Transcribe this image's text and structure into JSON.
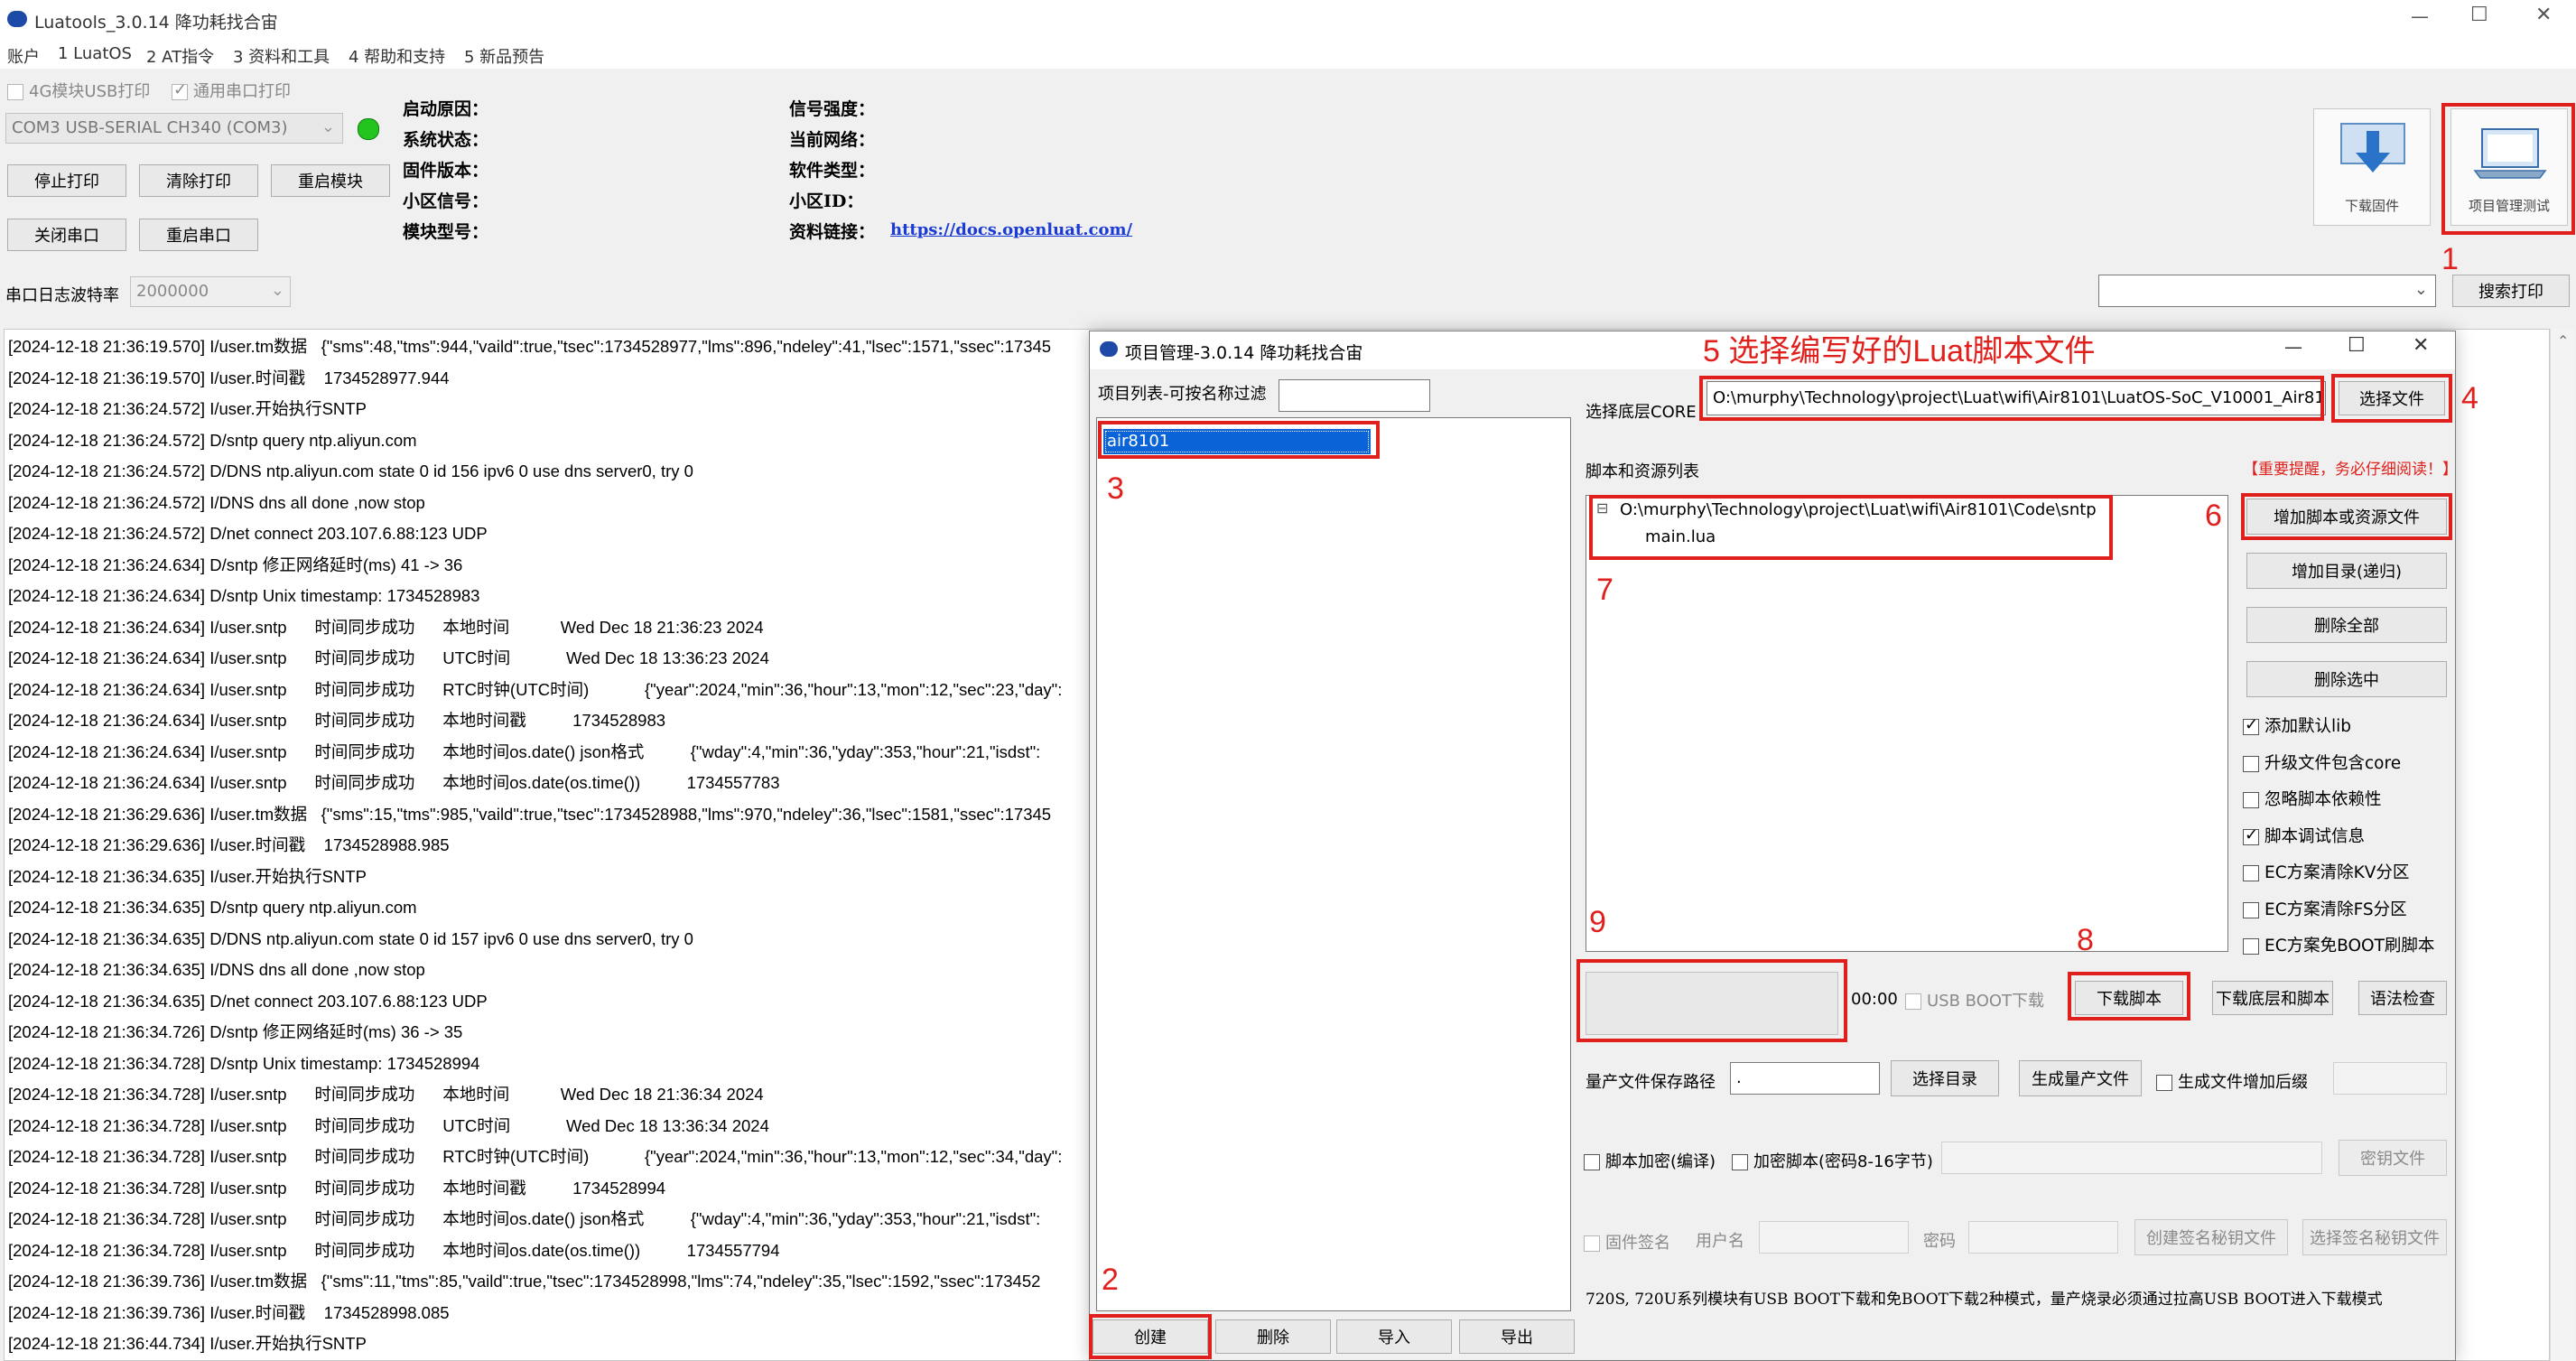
{
  "app": {
    "title": "Luatools_3.0.14 降功耗找合宙",
    "menu": [
      "账户",
      "1 LuatOS",
      "2 AT指令",
      "3 资料和工具",
      "4 帮助和支持",
      "5 新品预告"
    ],
    "window_controls": {
      "minimize": "—",
      "maximize": "☐",
      "close": "✕"
    }
  },
  "top": {
    "chk_4g": "4G模块USB打印",
    "chk_serial": "通用串口打印",
    "port_value": "COM3 USB-SERIAL CH340 (COM3)",
    "status_color": "#22c41e",
    "buttons": {
      "stop_print": "停止打印",
      "clear_print": "清除打印",
      "restart_module": "重启模块",
      "close_port": "关闭串口",
      "restart_port": "重启串口"
    },
    "info": {
      "boot_reason": "启动原因：",
      "system_status": "系统状态：",
      "firmware_version": "固件版本：",
      "cell_signal": "小区信号：",
      "module_model": "模块型号：",
      "signal_strength": "信号强度：",
      "current_network": "当前网络：",
      "software_type": "软件类型：",
      "cell_id": "小区ID：",
      "doc_link": "资料链接：",
      "doc_url": "https://docs.openluat.com/"
    },
    "baud_label": "串口日志波特率",
    "baud_value": "2000000",
    "search_print": "搜索打印",
    "tool_download_firmware": "下载固件",
    "tool_project_test": "项目管理测试"
  },
  "log_lines": [
    "[2024-12-18 21:36:19.570] I/user.tm数据   {\"sms\":48,\"tms\":944,\"vaild\":true,\"tsec\":1734528977,\"lms\":896,\"ndeley\":41,\"lsec\":1571,\"ssec\":17345",
    "[2024-12-18 21:36:19.570] I/user.时间戳    1734528977.944",
    "[2024-12-18 21:36:24.572] I/user.开始执行SNTP",
    "[2024-12-18 21:36:24.572] D/sntp query ntp.aliyun.com",
    "[2024-12-18 21:36:24.572] D/DNS ntp.aliyun.com state 0 id 156 ipv6 0 use dns server0, try 0",
    "[2024-12-18 21:36:24.572] I/DNS dns all done ,now stop",
    "[2024-12-18 21:36:24.572] D/net connect 203.107.6.88:123 UDP",
    "[2024-12-18 21:36:24.634] D/sntp 修正网络延时(ms) 41 -> 36",
    "[2024-12-18 21:36:24.634] D/sntp Unix timestamp: 1734528983",
    "[2024-12-18 21:36:24.634] I/user.sntp      时间同步成功      本地时间           Wed Dec 18 21:36:23 2024",
    "[2024-12-18 21:36:24.634] I/user.sntp      时间同步成功      UTC时间            Wed Dec 18 13:36:23 2024",
    "[2024-12-18 21:36:24.634] I/user.sntp      时间同步成功      RTC时钟(UTC时间)            {\"year\":2024,\"min\":36,\"hour\":13,\"mon\":12,\"sec\":23,\"day\":",
    "[2024-12-18 21:36:24.634] I/user.sntp      时间同步成功      本地时间戳          1734528983",
    "[2024-12-18 21:36:24.634] I/user.sntp      时间同步成功      本地时间os.date() json格式          {\"wday\":4,\"min\":36,\"yday\":353,\"hour\":21,\"isdst\":",
    "[2024-12-18 21:36:24.634] I/user.sntp      时间同步成功      本地时间os.date(os.time())          1734557783",
    "[2024-12-18 21:36:29.636] I/user.tm数据   {\"sms\":15,\"tms\":985,\"vaild\":true,\"tsec\":1734528988,\"lms\":970,\"ndeley\":36,\"lsec\":1581,\"ssec\":17345",
    "[2024-12-18 21:36:29.636] I/user.时间戳    1734528988.985",
    "[2024-12-18 21:36:34.635] I/user.开始执行SNTP",
    "[2024-12-18 21:36:34.635] D/sntp query ntp.aliyun.com",
    "[2024-12-18 21:36:34.635] D/DNS ntp.aliyun.com state 0 id 157 ipv6 0 use dns server0, try 0",
    "[2024-12-18 21:36:34.635] I/DNS dns all done ,now stop",
    "[2024-12-18 21:36:34.635] D/net connect 203.107.6.88:123 UDP",
    "[2024-12-18 21:36:34.726] D/sntp 修正网络延时(ms) 36 -> 35",
    "[2024-12-18 21:36:34.728] D/sntp Unix timestamp: 1734528994",
    "[2024-12-18 21:36:34.728] I/user.sntp      时间同步成功      本地时间           Wed Dec 18 21:36:34 2024",
    "[2024-12-18 21:36:34.728] I/user.sntp      时间同步成功      UTC时间            Wed Dec 18 13:36:34 2024",
    "[2024-12-18 21:36:34.728] I/user.sntp      时间同步成功      RTC时钟(UTC时间)            {\"year\":2024,\"min\":36,\"hour\":13,\"mon\":12,\"sec\":34,\"day\":",
    "[2024-12-18 21:36:34.728] I/user.sntp      时间同步成功      本地时间戳          1734528994",
    "[2024-12-18 21:36:34.728] I/user.sntp      时间同步成功      本地时间os.date() json格式          {\"wday\":4,\"min\":36,\"yday\":353,\"hour\":21,\"isdst\":",
    "[2024-12-18 21:36:34.728] I/user.sntp      时间同步成功      本地时间os.date(os.time())          1734557794",
    "[2024-12-18 21:36:39.736] I/user.tm数据   {\"sms\":11,\"tms\":85,\"vaild\":true,\"tsec\":1734528998,\"lms\":74,\"ndeley\":35,\"lsec\":1592,\"ssec\":173452",
    "[2024-12-18 21:36:39.736] I/user.时间戳    1734528998.085",
    "[2024-12-18 21:36:44.734] I/user.开始执行SNTP"
  ],
  "dialog": {
    "title": "项目管理-3.0.14 降功耗找合宙",
    "filter_label": "项目列表-可按名称过滤",
    "projects": [
      "air8101"
    ],
    "core_label": "选择底层CORE",
    "core_path": "O:\\murphy\\Technology\\project\\Luat\\wifi\\Air8101\\LuatOS-SoC_V10001_Air810",
    "choose_file": "选择文件",
    "scripts_label": "脚本和资源列表",
    "warning": "【重要提醒，务必仔细阅读！】",
    "tree_root": "O:\\murphy\\Technology\\project\\Luat\\wifi\\Air8101\\Code\\sntp",
    "tree_child": "main.lua",
    "tree_toggle": "⊟",
    "btn_add_script": "增加脚本或资源文件",
    "btn_add_dir": "增加目录(递归)",
    "btn_delete_all": "删除全部",
    "btn_delete_selected": "删除选中",
    "options": [
      {
        "label": "添加默认lib",
        "checked": true
      },
      {
        "label": "升级文件包含core",
        "checked": false
      },
      {
        "label": "忽略脚本依赖性",
        "checked": false
      },
      {
        "label": "脚本调试信息",
        "checked": true
      },
      {
        "label": "EC方案清除KV分区",
        "checked": false
      },
      {
        "label": "EC方案清除FS分区",
        "checked": false
      },
      {
        "label": "EC方案免BOOT刷脚本",
        "checked": false
      }
    ],
    "timer": "00:00",
    "usb_boot": "USB BOOT下载",
    "btn_download_script": "下载脚本",
    "btn_download_core_script": "下载底层和脚本",
    "btn_syntax_check": "语法检查",
    "mass_path_label": "量产文件保存路径",
    "mass_path_value": ".",
    "btn_choose_dir": "选择目录",
    "btn_gen_mass": "生成量产文件",
    "chk_suffix": "生成文件增加后缀",
    "chk_encrypt_compile": "脚本加密(编译)",
    "chk_encrypt_script": "加密脚本(密码8-16字节)",
    "btn_key_file": "密钥文件",
    "chk_firmware_sign": "固件签名",
    "username_label": "用户名",
    "password_label": "密码",
    "btn_create_sign_key": "创建签名秘钥文件",
    "btn_choose_sign_key": "选择签名秘钥文件",
    "footer_note": "720S, 720U系列模块有USB BOOT下载和免BOOT下载2种模式，量产烧录必须通过拉高USB BOOT进入下载模式",
    "btn_create": "创建",
    "btn_delete": "删除",
    "btn_import": "导入",
    "btn_export": "导出"
  },
  "annotations": {
    "n1": "1",
    "n2": "2",
    "n3": "3",
    "n4": "4",
    "n5": "5 选择编写好的Luat脚本文件",
    "n6": "6",
    "n7": "7",
    "n8": "8",
    "n9": "9",
    "color": "#e0201c"
  }
}
